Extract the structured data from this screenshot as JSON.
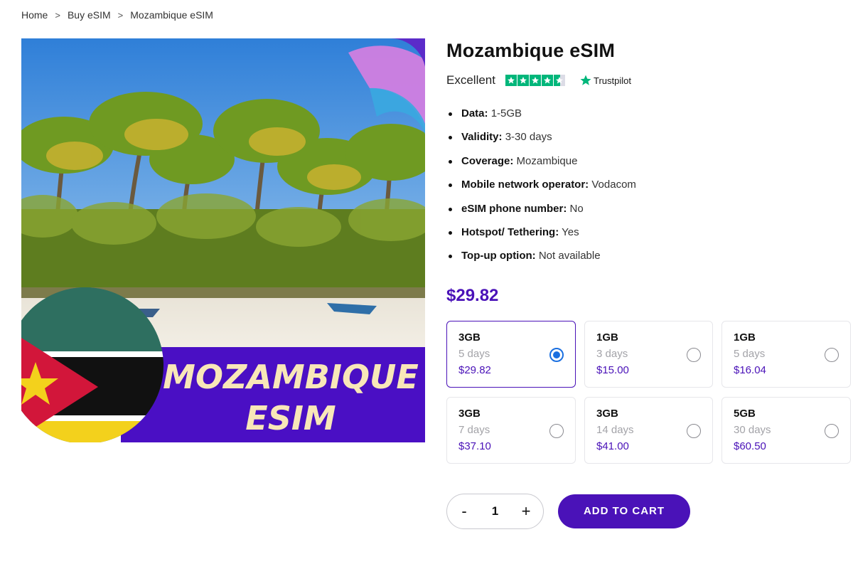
{
  "breadcrumb": {
    "items": [
      "Home",
      "Buy eSIM",
      "Mozambique eSIM"
    ],
    "separator": ">"
  },
  "image": {
    "banner_line1": "MOZAMBIQUE",
    "banner_line2": "ESIM"
  },
  "product": {
    "title": "Mozambique eSIM",
    "rating_label": "Excellent",
    "rating_stars": 4.5,
    "rating_provider": "Trustpilot",
    "features": [
      {
        "label": "Data:",
        "value": "1-5GB"
      },
      {
        "label": "Validity:",
        "value": "3-30 days"
      },
      {
        "label": "Coverage:",
        "value": "Mozambique"
      },
      {
        "label": "Mobile network operator:",
        "value": "Vodacom"
      },
      {
        "label": "eSIM phone number:",
        "value": "No"
      },
      {
        "label": "Hotspot/ Tethering:",
        "value": "Yes"
      },
      {
        "label": "Top-up option:",
        "value": "Not available"
      }
    ],
    "price": "$29.82"
  },
  "plans": [
    {
      "data": "3GB",
      "days": "5 days",
      "price": "$29.82",
      "selected": true
    },
    {
      "data": "1GB",
      "days": "3 days",
      "price": "$15.00",
      "selected": false
    },
    {
      "data": "1GB",
      "days": "5 days",
      "price": "$16.04",
      "selected": false
    },
    {
      "data": "3GB",
      "days": "7 days",
      "price": "$37.10",
      "selected": false
    },
    {
      "data": "3GB",
      "days": "14 days",
      "price": "$41.00",
      "selected": false
    },
    {
      "data": "5GB",
      "days": "30 days",
      "price": "$60.50",
      "selected": false
    }
  ],
  "quantity": {
    "minus": "-",
    "value": "1",
    "plus": "+"
  },
  "cart": {
    "label": "ADD TO CART"
  },
  "colors": {
    "accent": "#4a12b8",
    "radio": "#1a6fe0",
    "trustpilot": "#00b67a"
  }
}
